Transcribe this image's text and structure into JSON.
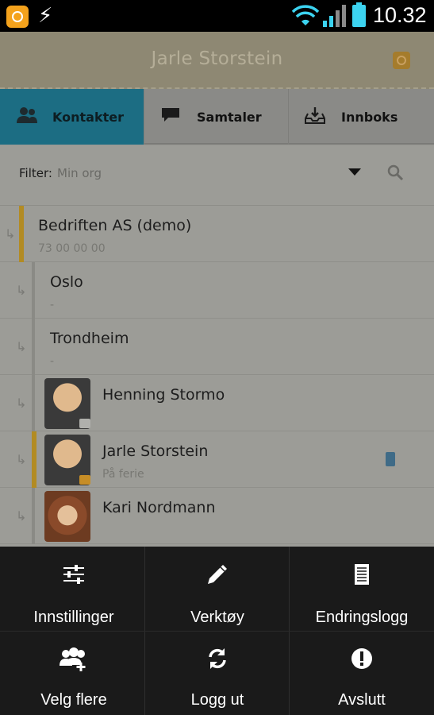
{
  "status_bar": {
    "time": "10.32"
  },
  "header": {
    "title": "Jarle Storstein"
  },
  "tabs": [
    {
      "label": "Kontakter",
      "icon": "contacts-icon",
      "active": true
    },
    {
      "label": "Samtaler",
      "icon": "chat-bubble-icon",
      "active": false
    },
    {
      "label": "Innboks",
      "icon": "inbox-icon",
      "active": false
    }
  ],
  "filter": {
    "label": "Filter:",
    "value": "Min org"
  },
  "contacts": [
    {
      "name": "Bedriften AS (demo)",
      "sub": "73 00 00 00"
    },
    {
      "name": "Oslo",
      "sub": "-"
    },
    {
      "name": "Trondheim",
      "sub": "-"
    },
    {
      "name": "Henning Stormo",
      "sub": ""
    },
    {
      "name": "Jarle Storstein",
      "sub": "På ferie"
    },
    {
      "name": "Kari Nordmann",
      "sub": ""
    }
  ],
  "menu": {
    "items": [
      {
        "label": "Innstillinger",
        "icon": "settings-sliders-icon"
      },
      {
        "label": "Verktøy",
        "icon": "pencil-icon"
      },
      {
        "label": "Endringslogg",
        "icon": "document-icon"
      },
      {
        "label": "Velg flere",
        "icon": "select-multiple-icon"
      },
      {
        "label": "Logg ut",
        "icon": "refresh-icon"
      },
      {
        "label": "Avslutt",
        "icon": "exit-alert-icon"
      }
    ]
  },
  "colors": {
    "tab_active": "#1c6d83",
    "status_flag": "#b28b23",
    "battery": "#3cd3f0",
    "app_icon": "#f4a21c"
  }
}
